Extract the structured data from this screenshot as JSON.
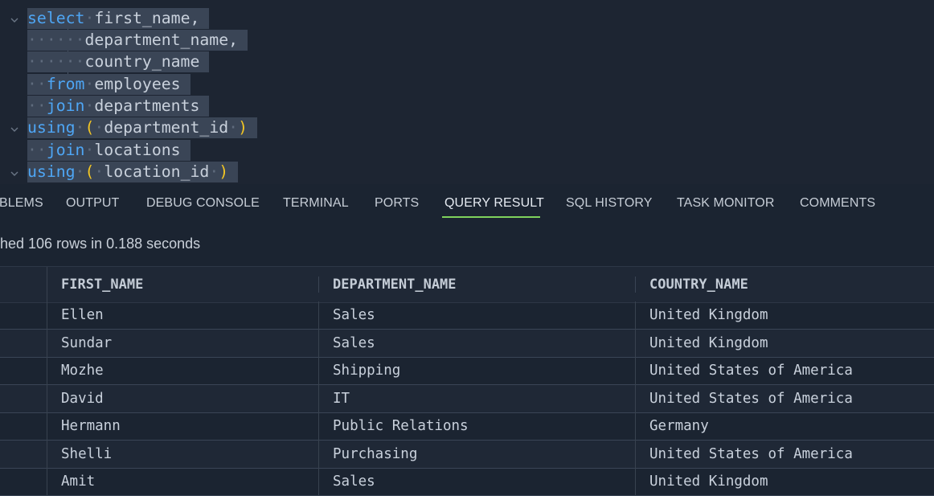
{
  "editor": {
    "lines": [
      {
        "tokens": [
          [
            "kw",
            "select"
          ],
          [
            "ws",
            "·"
          ],
          [
            "id",
            "first_name,"
          ]
        ]
      },
      {
        "tokens": [
          [
            "ws",
            "······"
          ],
          [
            "id",
            "department_name,"
          ]
        ]
      },
      {
        "tokens": [
          [
            "ws",
            "······"
          ],
          [
            "id",
            "country_name"
          ]
        ]
      },
      {
        "tokens": [
          [
            "ws",
            "··"
          ],
          [
            "kw",
            "from"
          ],
          [
            "ws",
            "·"
          ],
          [
            "id",
            "employees"
          ]
        ]
      },
      {
        "tokens": [
          [
            "ws",
            "··"
          ],
          [
            "kw",
            "join"
          ],
          [
            "ws",
            "·"
          ],
          [
            "id",
            "departments"
          ]
        ]
      },
      {
        "tokens": [
          [
            "kw",
            "using"
          ],
          [
            "ws",
            "·"
          ],
          [
            "paren",
            "("
          ],
          [
            "ws",
            "·"
          ],
          [
            "id",
            "department_id"
          ],
          [
            "ws",
            "·"
          ],
          [
            "paren",
            ")"
          ]
        ]
      },
      {
        "tokens": [
          [
            "ws",
            "··"
          ],
          [
            "kw",
            "join"
          ],
          [
            "ws",
            "·"
          ],
          [
            "id",
            "locations"
          ]
        ]
      },
      {
        "tokens": [
          [
            "kw",
            "using"
          ],
          [
            "ws",
            "·"
          ],
          [
            "paren",
            "("
          ],
          [
            "ws",
            "·"
          ],
          [
            "id",
            "location_id"
          ],
          [
            "ws",
            "·"
          ],
          [
            "paren",
            ")"
          ]
        ]
      }
    ],
    "colors": {
      "keyword": "#4ea6f5",
      "paren": "#f3c624",
      "selection": "#3a4556"
    }
  },
  "panel": {
    "tabs": [
      {
        "label": "BLEMS"
      },
      {
        "label": "OUTPUT"
      },
      {
        "label": "DEBUG CONSOLE"
      },
      {
        "label": "TERMINAL"
      },
      {
        "label": "PORTS"
      },
      {
        "label": "QUERY RESULT",
        "active": true
      },
      {
        "label": "SQL HISTORY"
      },
      {
        "label": "TASK MONITOR"
      },
      {
        "label": "COMMENTS"
      }
    ],
    "status": "hed 106 rows in 0.188 seconds",
    "accent": "#7fd35c"
  },
  "grid": {
    "columns": [
      "FIRST_NAME",
      "DEPARTMENT_NAME",
      "COUNTRY_NAME"
    ],
    "rows": [
      [
        "Ellen",
        "Sales",
        "United Kingdom"
      ],
      [
        "Sundar",
        "Sales",
        "United Kingdom"
      ],
      [
        "Mozhe",
        "Shipping",
        "United States of America"
      ],
      [
        "David",
        "IT",
        "United States of America"
      ],
      [
        "Hermann",
        "Public Relations",
        "Germany"
      ],
      [
        "Shelli",
        "Purchasing",
        "United States of America"
      ],
      [
        "Amit",
        "Sales",
        "United Kingdom"
      ]
    ]
  }
}
